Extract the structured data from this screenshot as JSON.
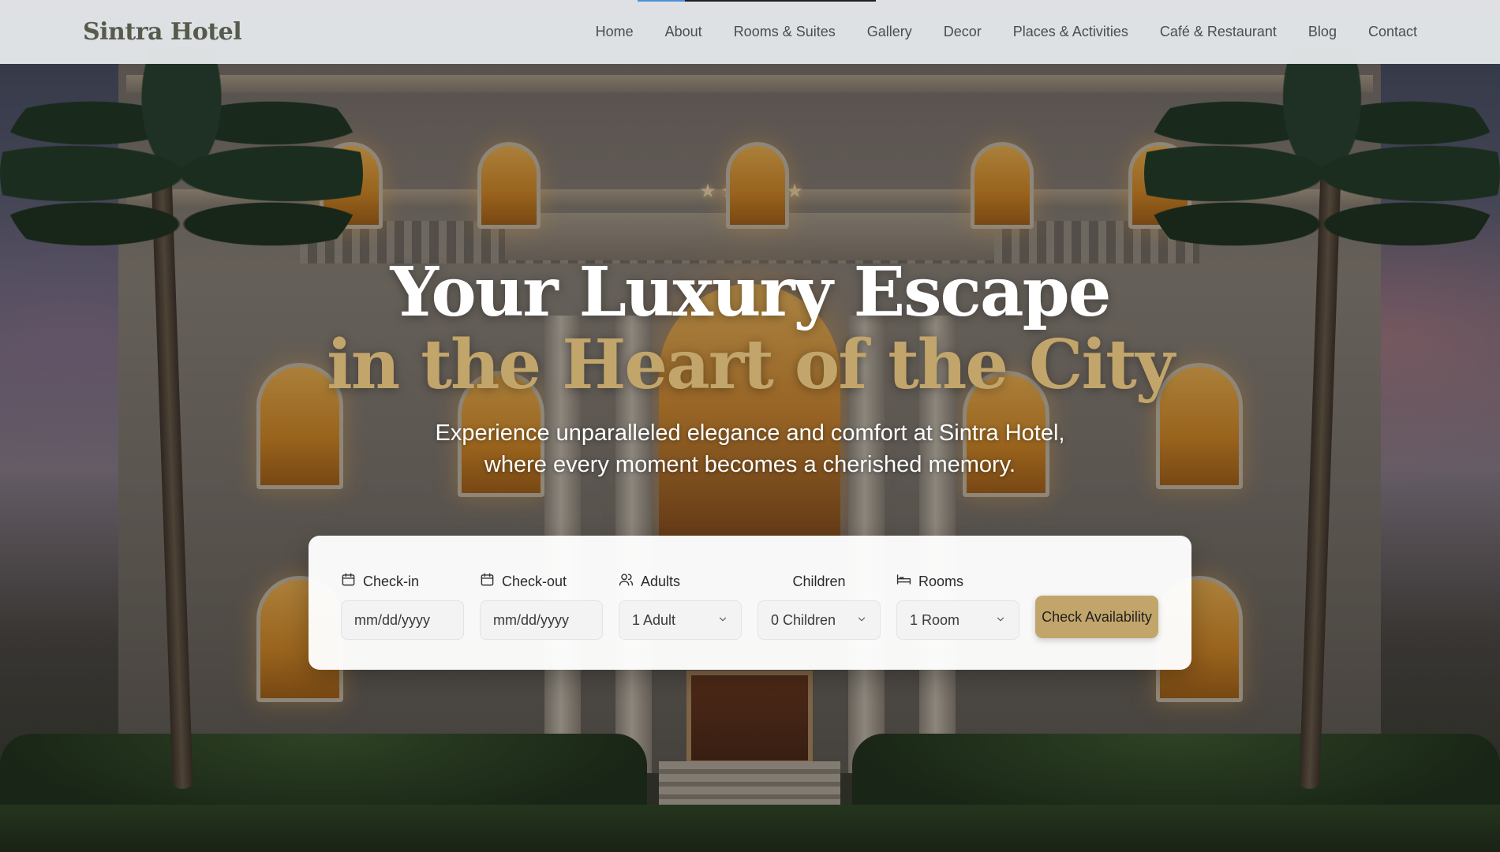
{
  "site": {
    "brand": "Sintra Hotel"
  },
  "nav": {
    "items": [
      {
        "label": "Home"
      },
      {
        "label": "About"
      },
      {
        "label": "Rooms & Suites"
      },
      {
        "label": "Gallery"
      },
      {
        "label": "Decor"
      },
      {
        "label": "Places & Activities"
      },
      {
        "label": "Café & Restaurant"
      },
      {
        "label": "Blog"
      },
      {
        "label": "Contact"
      }
    ]
  },
  "hero": {
    "headline_line1": "Your Luxury Escape",
    "headline_line2": "in the Heart of the City",
    "subtitle": "Experience unparalleled elegance and comfort at Sintra Hotel, where every moment becomes a cherished memory.",
    "facade_stars": "★★★★★"
  },
  "booking": {
    "checkin": {
      "label": "Check-in",
      "value": "mm/dd/yyyy",
      "icon": "calendar-icon"
    },
    "checkout": {
      "label": "Check-out",
      "value": "mm/dd/yyyy",
      "icon": "calendar-icon"
    },
    "adults": {
      "label": "Adults",
      "value": "1 Adult",
      "icon": "users-icon"
    },
    "children": {
      "label": "Children",
      "value": "0 Children"
    },
    "rooms": {
      "label": "Rooms",
      "value": "1 Room",
      "icon": "bed-icon"
    },
    "cta_label": "Check Availability"
  },
  "colors": {
    "accent_gold": "#c2a56b",
    "brand_text": "#575a4c",
    "navbar_bg": "#eceef0"
  }
}
